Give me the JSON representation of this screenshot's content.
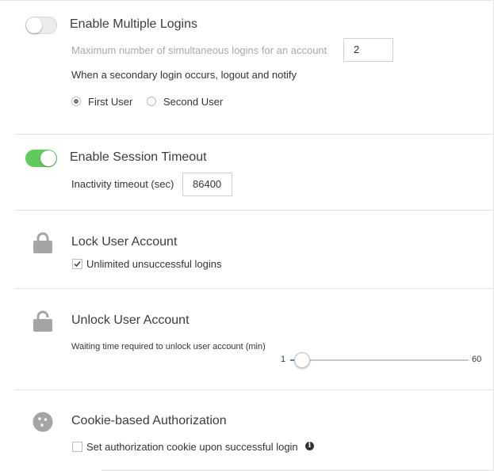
{
  "multiple_logins": {
    "title": "Enable Multiple Logins",
    "enabled": false,
    "max_label": "Maximum number of simultaneous logins for an account",
    "max_value": "2",
    "secondary_label": "When a secondary login occurs, logout and notify",
    "options": [
      {
        "label": "First User",
        "selected": true
      },
      {
        "label": "Second User",
        "selected": false
      }
    ]
  },
  "session_timeout": {
    "title": "Enable Session Timeout",
    "enabled": true,
    "inactivity_label": "Inactivity timeout (sec)",
    "inactivity_value": "86400"
  },
  "lock_account": {
    "title": "Lock User Account",
    "checkbox_label": "Unlimited unsuccessful logins",
    "checked": true
  },
  "unlock_account": {
    "title": "Unlock User Account",
    "slider_label": "Waiting time required to unlock user account (min)",
    "min": "1",
    "max": "60",
    "value": 5
  },
  "cookie_auth": {
    "title": "Cookie-based Authorization",
    "checkbox_label": "Set authorization cookie upon successful login",
    "checked": false
  },
  "colors": {
    "toggle_on": "#5fcb5b",
    "slider_fill": "#3a8fd8",
    "icon_gray": "#a5a5a5"
  }
}
